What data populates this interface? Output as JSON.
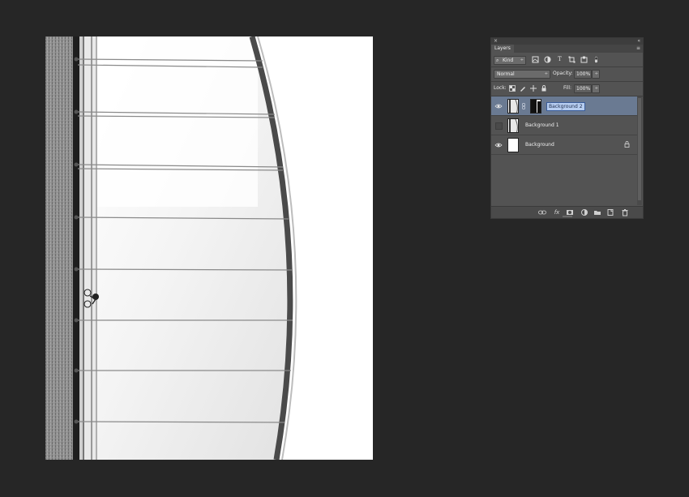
{
  "layers_panel": {
    "close_glyph": "×",
    "collapse_glyph": "«",
    "tab_label": "Layers",
    "menu_glyph": "≡",
    "filter": {
      "kind_label": "Kind",
      "search_glyph": "⌕",
      "arrow": "÷"
    },
    "filter_icons": [
      "image-filter-icon",
      "adjustment-filter-icon",
      "type-filter-icon",
      "shape-filter-icon",
      "smart-object-filter-icon",
      "filter-toggle-icon"
    ],
    "blend_mode": "Normal",
    "opacity_label": "Opacity:",
    "opacity_value": "100%",
    "lock_label": "Lock:",
    "fill_label": "Fill:",
    "fill_value": "100%",
    "layers": [
      {
        "name": "Background 2",
        "visible": true,
        "selected": true,
        "has_mask": true,
        "locked": false
      },
      {
        "name": "Background 1",
        "visible": false,
        "selected": false,
        "has_mask": false,
        "locked": false
      },
      {
        "name": "Background",
        "visible": true,
        "selected": false,
        "has_mask": false,
        "locked": true
      }
    ],
    "bottom_icons": [
      "link-layers-icon",
      "fx-icon",
      "add-mask-icon",
      "adjustment-layer-icon",
      "new-group-icon",
      "new-layer-icon",
      "delete-layer-icon"
    ],
    "fx_text": "fx"
  },
  "colors": {
    "workspace": "#262626",
    "panel": "#535353",
    "selected_layer": "#6a7a92",
    "edit_highlight": "#b6cdf0"
  }
}
